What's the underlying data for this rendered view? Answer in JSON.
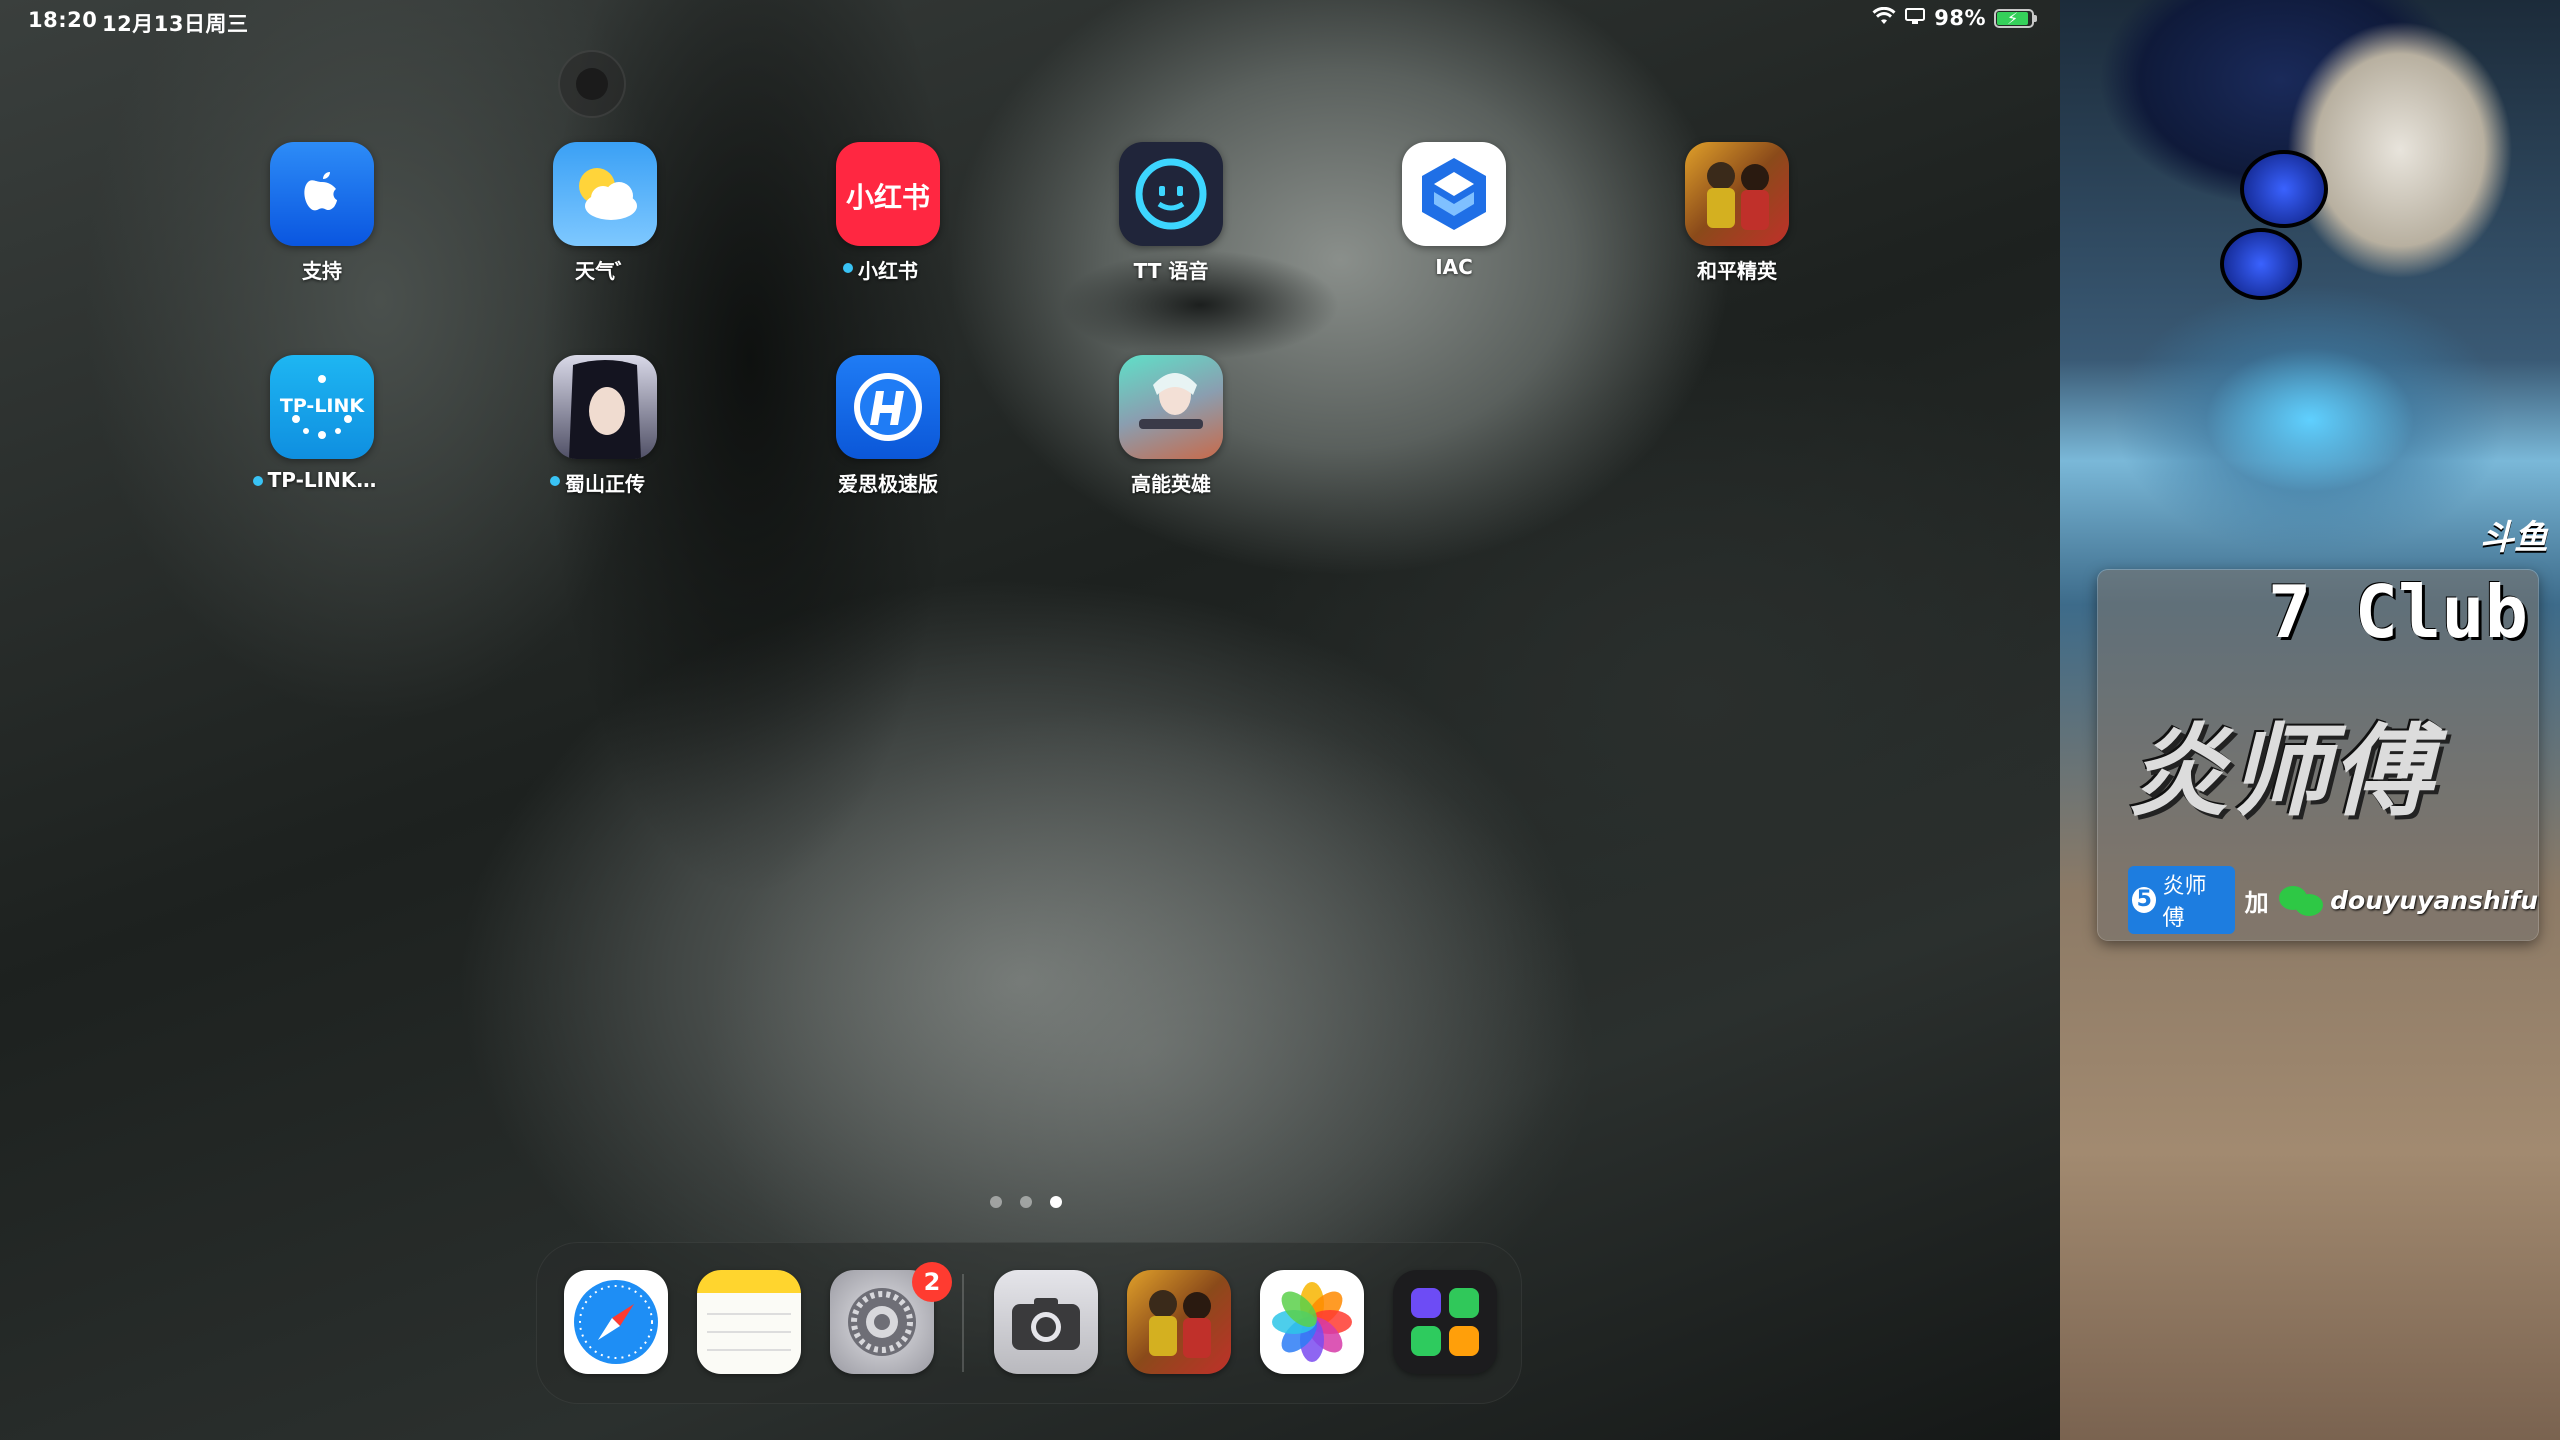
{
  "status_bar": {
    "time": "18:20",
    "date": "12月13日周三",
    "battery_percent": "98%",
    "battery_level": 0.98,
    "charging": true,
    "icons": [
      "wifi-icon",
      "screen-mirror-icon",
      "battery-icon"
    ]
  },
  "home": {
    "apps": [
      {
        "label": "支持",
        "icon": "apple-support-icon",
        "has_new_dot": false
      },
      {
        "label": "天气゛",
        "icon": "weather-icon",
        "has_new_dot": false
      },
      {
        "label": "小红书",
        "icon": "xiaohongshu-icon",
        "icon_text": "小红书",
        "has_new_dot": true
      },
      {
        "label": "TT 语音",
        "icon": "tt-voice-icon",
        "has_new_dot": false
      },
      {
        "label": "IAC",
        "icon": "iac-icon",
        "has_new_dot": false
      },
      {
        "label": "和平精英",
        "icon": "peace-elite-icon",
        "has_new_dot": false
      },
      {
        "label": "TP-LINK…",
        "icon": "tplink-icon",
        "icon_text": "TP-LINK",
        "has_new_dot": true
      },
      {
        "label": "蜀山正传",
        "icon": "shushan-icon",
        "has_new_dot": true
      },
      {
        "label": "爱思极速版",
        "icon": "aisi-icon",
        "has_new_dot": false
      },
      {
        "label": "高能英雄",
        "icon": "gaoneng-hero-icon",
        "has_new_dot": false
      }
    ],
    "page_count": 3,
    "current_page": 3
  },
  "dock": {
    "apps": [
      {
        "name": "Safari",
        "icon": "safari-icon"
      },
      {
        "name": "Notes",
        "icon": "notes-icon"
      },
      {
        "name": "Settings",
        "icon": "settings-icon",
        "badge": "2"
      },
      {
        "name": "Camera",
        "icon": "camera-icon"
      },
      {
        "name": "和平精英",
        "icon": "peace-elite-icon"
      },
      {
        "name": "Photos",
        "icon": "photos-icon"
      },
      {
        "name": "App Library",
        "icon": "app-library-icon"
      }
    ]
  },
  "overlay": {
    "platform_logo": "斗鱼",
    "club": "7 Club",
    "streamer_name": "炎师傅",
    "douyu_tag": "炎师傅",
    "add_text": "加",
    "wechat_id": "douyuyanshifu",
    "accent_color": "#1d7de0",
    "wechat_color": "#2ec845"
  }
}
